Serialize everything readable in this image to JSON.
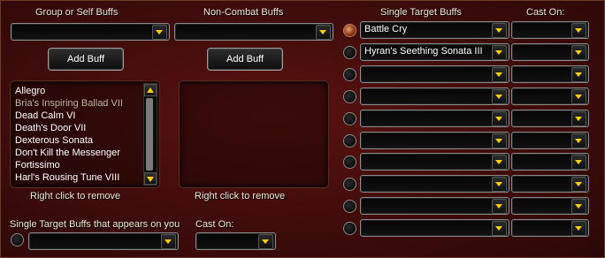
{
  "group_buffs": {
    "title": "Group or Self Buffs",
    "combo_value": "",
    "add_label": "Add Buff",
    "items": [
      "Allegro",
      "Bria's Inspiring Ballad VII",
      "Dead Calm VI",
      "Death's Door VII",
      "Dexterous Sonata",
      "Don't Kill the Messenger",
      "Fortissimo",
      "Harl's Rousing Tune VIII"
    ],
    "hint": "Right click to remove"
  },
  "noncombat_buffs": {
    "title": "Non-Combat Buffs",
    "combo_value": "",
    "add_label": "Add Buff",
    "hint": "Right click to remove"
  },
  "single_target": {
    "title": "Single Target Buffs",
    "cast_on_title": "Cast On:",
    "rows": [
      {
        "buff": "Battle Cry",
        "cast_on": "",
        "selected": true
      },
      {
        "buff": "Hyran's Seething Sonata III",
        "cast_on": "",
        "selected": false
      },
      {
        "buff": "",
        "cast_on": "",
        "selected": false
      },
      {
        "buff": "",
        "cast_on": "",
        "selected": false
      },
      {
        "buff": "",
        "cast_on": "",
        "selected": false
      },
      {
        "buff": "",
        "cast_on": "",
        "selected": false
      },
      {
        "buff": "",
        "cast_on": "",
        "selected": false
      },
      {
        "buff": "",
        "cast_on": "",
        "selected": false
      },
      {
        "buff": "",
        "cast_on": "",
        "selected": false
      },
      {
        "buff": "",
        "cast_on": "",
        "selected": false
      }
    ]
  },
  "appears_on_you": {
    "title": "Single Target Buffs that appears on you",
    "combo_value": "",
    "cast_on_title": "Cast On:",
    "cast_on_value": ""
  },
  "colors": {
    "accent": "#f5d000",
    "background": "#3e0c0b"
  }
}
